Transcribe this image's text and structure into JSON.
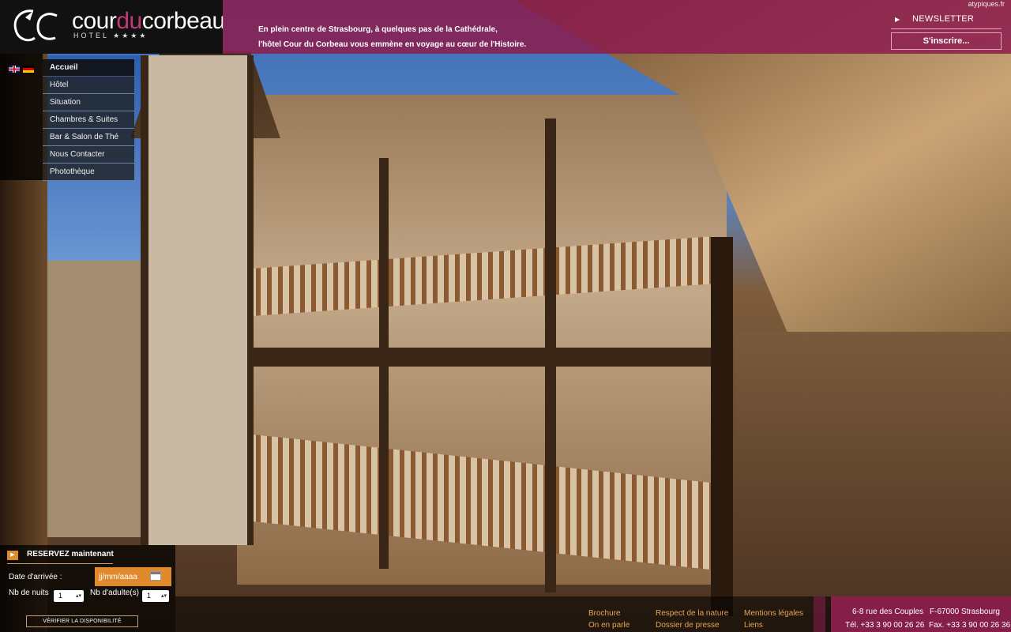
{
  "header": {
    "logo": {
      "name_pre": "cour",
      "name_accent": "du",
      "name_post": "corbeau",
      "subtitle": "HOTEL ★★★★"
    },
    "banner_lines": [
      "En plein centre de Strasbourg, à quelques pas de la Cathédrale,",
      "l'hôtel Cour du Corbeau vous emmène en voyage au cœur de l'Histoire."
    ],
    "credit": "atypiques.fr",
    "newsletter_label": "NEWSLETTER",
    "subscribe_label": "S'inscrire..."
  },
  "languages": [
    "english-flag",
    "german-flag"
  ],
  "menu": {
    "items": [
      {
        "label": "Accueil",
        "active": true
      },
      {
        "label": "Hôtel"
      },
      {
        "label": "Situation"
      },
      {
        "label": "Chambres & Suites"
      },
      {
        "label": "Bar & Salon de Thé"
      },
      {
        "label": "Nous Contacter"
      },
      {
        "label": "Photothèque"
      }
    ]
  },
  "booking": {
    "title": "RESERVEZ maintenant",
    "arrival_label": "Date d'arrivée :",
    "date_placeholder": "jj/mm/aaaa",
    "nights_label": "Nb de nuits",
    "nights_value": "1",
    "adults_label": "Nb d'adulte(s)",
    "adults_value": "1",
    "verify_label": "VÉRIFIER LA DISPONIBILITÉ"
  },
  "footer": {
    "links": [
      "Brochure",
      "On en parle",
      "Respect de la nature",
      "Dossier de presse",
      "Mentions légales",
      "Liens"
    ]
  },
  "contact": {
    "address": "6-8 rue des Couples",
    "city": "F-67000 Strasbourg",
    "tel": "Tél. +33 3 90 00 26 26",
    "fax": "Fax. +33 3 90 00 26 36"
  },
  "colors": {
    "brand_magenta": "#8c1c4e",
    "accent_orange": "#e08a2e",
    "link_gold": "#e3a657"
  }
}
